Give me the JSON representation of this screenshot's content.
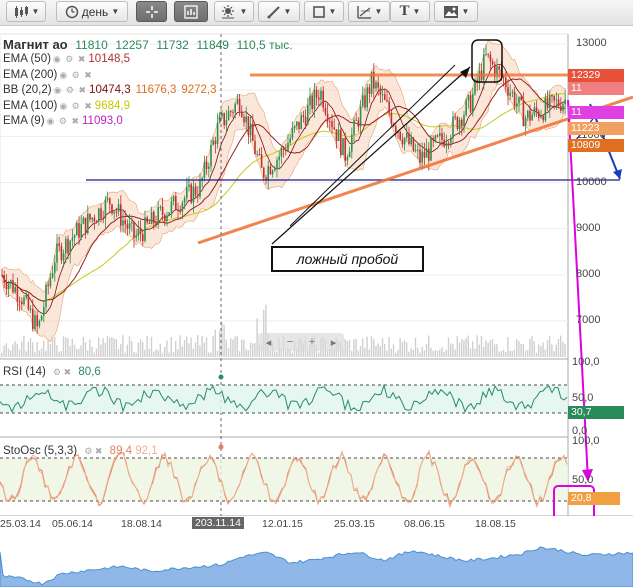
{
  "toolbar": {
    "period_label": "день",
    "text_tool_label": "T"
  },
  "instrument": {
    "name": "Магнит ао",
    "open": "11810",
    "high": "12257",
    "low": "11732",
    "close": "11849",
    "volume": "110,5 тыс."
  },
  "indicators": [
    {
      "name": "EMA (50)",
      "values": [
        "10148,5"
      ],
      "colors": [
        "#b03030"
      ]
    },
    {
      "name": "EMA (200)",
      "values": [
        ""
      ],
      "colors": [
        "#b03030"
      ]
    },
    {
      "name": "BB (20,2)",
      "values": [
        "10474,3",
        "11676,3",
        "9272,3"
      ],
      "colors": [
        "#7a1010",
        "#e07020",
        "#e07020"
      ]
    },
    {
      "name": "EMA (100)",
      "values": [
        "9684,9"
      ],
      "colors": [
        "#c8c800"
      ]
    },
    {
      "name": "EMA (9)",
      "values": [
        "11093,0"
      ],
      "colors": [
        "#c020c0"
      ]
    }
  ],
  "price_axis": [
    "13000",
    "12000",
    "11000",
    "10000",
    "9000",
    "8000",
    "7000"
  ],
  "price_tags": [
    {
      "value": "12329",
      "color": "#e8503a"
    },
    {
      "value": "11",
      "color": "#f08080"
    },
    {
      "value": "11",
      "color": "#e040e0"
    },
    {
      "value": "11223",
      "color": "#f0a060"
    },
    {
      "value": "10809",
      "color": "#e07020"
    }
  ],
  "annotation": "ложный пробой",
  "navbar_buttons": [
    "◂",
    "−",
    "+",
    "▸"
  ],
  "rsi": {
    "label": "RSI (14)",
    "value": "80,6",
    "axis": [
      "100,0",
      "50,0",
      "0,0"
    ],
    "tag": "30,7"
  },
  "stoch": {
    "label": "StoOsc (5,3,3)",
    "value1": "89,4",
    "value2": "92,1",
    "axis": [
      "100,0",
      "50,0"
    ],
    "tag": "20,8"
  },
  "dates": [
    "25.03.14",
    "05.06.14",
    "18.08.14",
    "203.11.14",
    "12.01.15",
    "25.03.15",
    "08.06.15",
    "18.08.15"
  ],
  "colors": {
    "toolbar_active": "#777777",
    "candle_up": "#2f8f4f",
    "candle_down": "#c03030",
    "support_line": "#f07030",
    "level_line": "#1a1a8a",
    "stoch_line": "#e08060",
    "rsi_line": "#2a8a6a",
    "annotation_magenta": "#e000e0",
    "nav_fill": "#4a90d0"
  },
  "icons": [
    "candles-icon",
    "clock-icon",
    "crosshair-icon",
    "indicator-icon",
    "settings-icon",
    "pencil-icon",
    "square-icon",
    "fibonacci-icon",
    "text-icon",
    "image-icon"
  ]
}
